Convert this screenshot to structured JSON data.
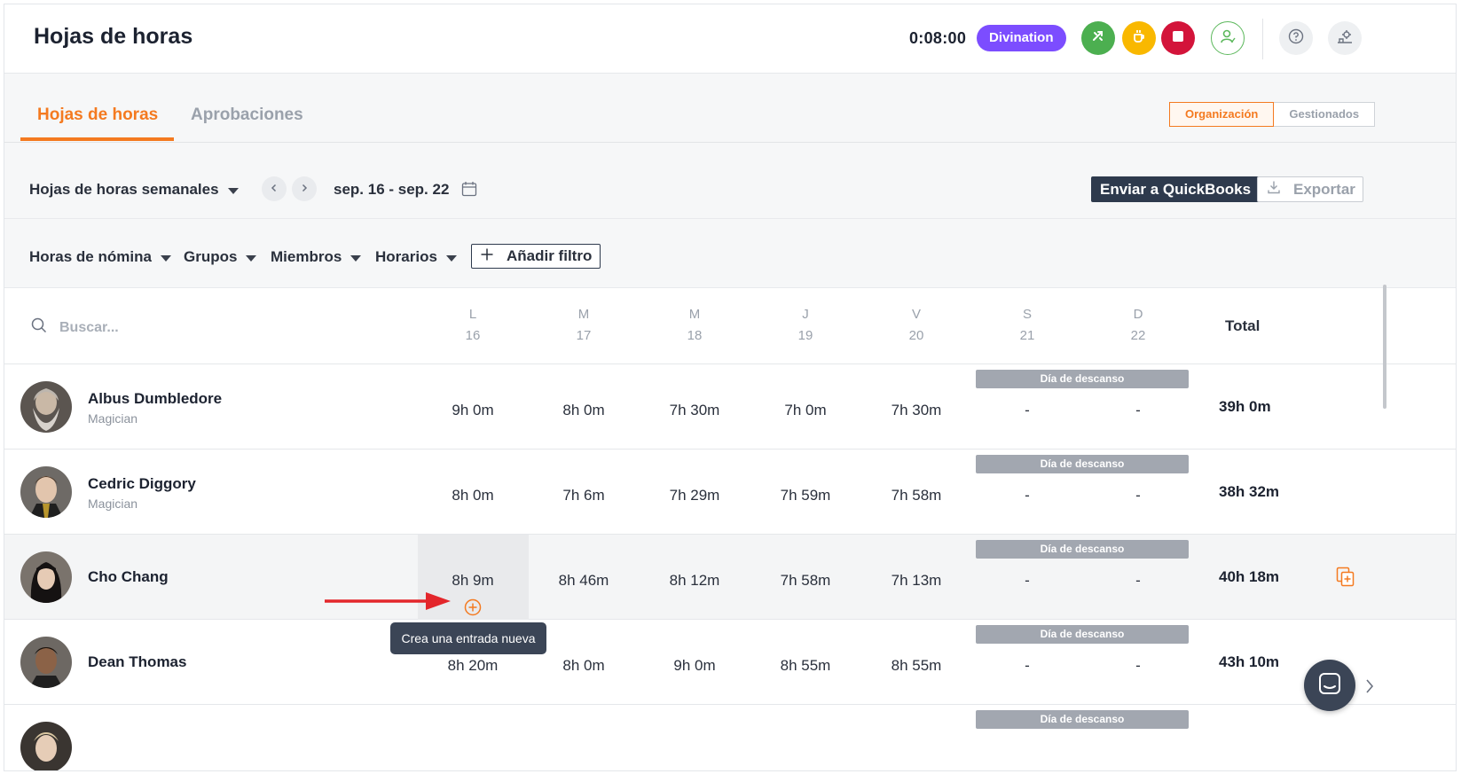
{
  "header": {
    "title": "Hojas de horas",
    "timer": "0:08:00",
    "project": "Divination",
    "colors": {
      "project": "#7c4dff",
      "accent": "#f47a20",
      "green": "#4caf50",
      "yellow": "#f9b800",
      "red": "#d3143a"
    }
  },
  "tabs": {
    "items": [
      "Hojas de horas",
      "Aprobaciones"
    ],
    "active": "Hojas de horas"
  },
  "scope": {
    "options": [
      "Organización",
      "Gestionados"
    ],
    "active": "Organización"
  },
  "toolbar": {
    "view": "Hojas de horas semanales",
    "date_range": "sep. 16 - sep. 22",
    "quickbooks": "Enviar a QuickBooks",
    "export": "Exportar"
  },
  "filters": {
    "items": [
      "Horas de nómina",
      "Grupos",
      "Miembros",
      "Horarios"
    ],
    "add": "Añadir filtro"
  },
  "table": {
    "search_placeholder": "Buscar...",
    "days": [
      {
        "letter": "L",
        "num": "16"
      },
      {
        "letter": "M",
        "num": "17"
      },
      {
        "letter": "M",
        "num": "18"
      },
      {
        "letter": "J",
        "num": "19"
      },
      {
        "letter": "V",
        "num": "20"
      },
      {
        "letter": "S",
        "num": "21"
      },
      {
        "letter": "D",
        "num": "22"
      }
    ],
    "total_label": "Total",
    "rest_label": "Día de descanso",
    "rows": [
      {
        "name": "Albus Dumbledore",
        "role": "Magician",
        "hours": [
          "9h 0m",
          "8h 0m",
          "7h 30m",
          "7h 0m",
          "7h 30m",
          "-",
          "-"
        ],
        "total": "39h 0m"
      },
      {
        "name": "Cedric Diggory",
        "role": "Magician",
        "hours": [
          "8h 0m",
          "7h 6m",
          "7h 29m",
          "7h 59m",
          "7h 58m",
          "-",
          "-"
        ],
        "total": "38h 32m"
      },
      {
        "name": "Cho Chang",
        "role": "",
        "hours": [
          "8h 9m",
          "8h 46m",
          "8h 12m",
          "7h 58m",
          "7h 13m",
          "-",
          "-"
        ],
        "total": "40h 18m"
      },
      {
        "name": "Dean Thomas",
        "role": "",
        "hours": [
          "8h 20m",
          "8h 0m",
          "9h 0m",
          "8h 55m",
          "8h 55m",
          "-",
          "-"
        ],
        "total": "43h 10m"
      }
    ]
  },
  "tooltip": "Crea una entrada nueva"
}
